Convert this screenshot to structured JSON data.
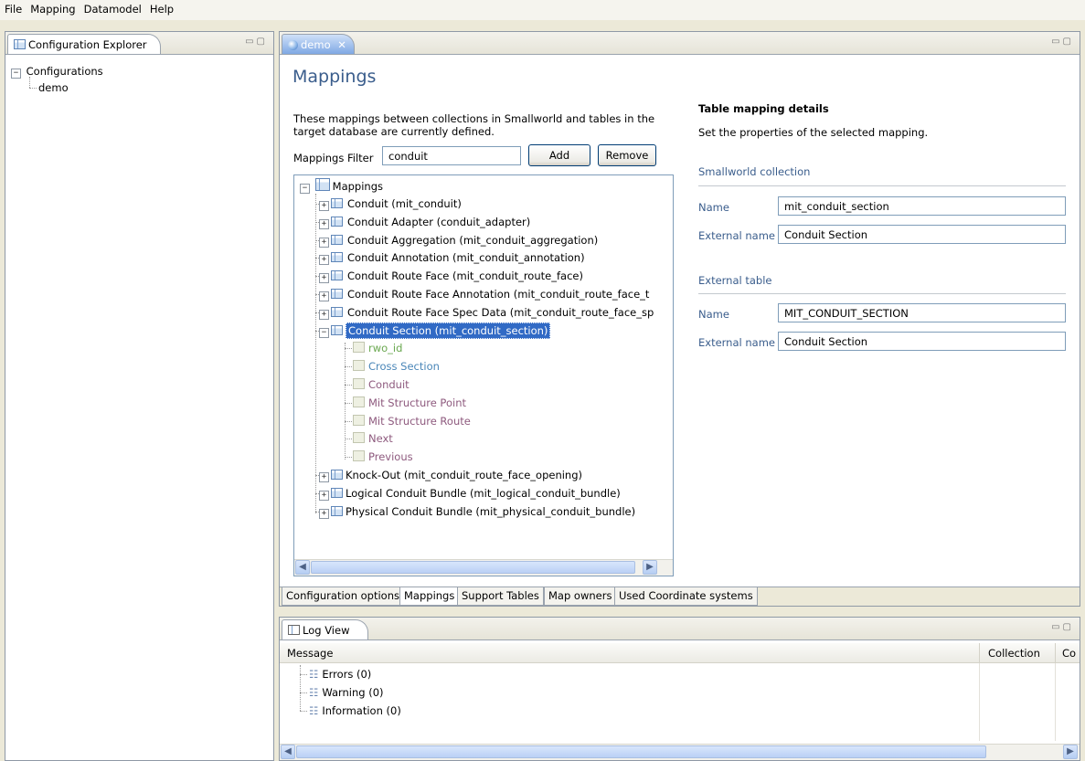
{
  "menu": [
    "File",
    "Mapping",
    "Datamodel",
    "Help"
  ],
  "explorer": {
    "tab_label": "Configuration Explorer",
    "root": "Configurations",
    "child": "demo"
  },
  "editor": {
    "tab_label": "demo",
    "title": "Mappings",
    "description_line1": "These mappings between collections in Smallworld and tables in the",
    "description_line2": "target database are currently defined.",
    "filter_label": "Mappings Filter",
    "filter_value": "conduit",
    "add_label": "Add",
    "remove_label": "Remove",
    "tree_root": "Mappings",
    "tree_items": [
      "Conduit (mit_conduit)",
      "Conduit Adapter (conduit_adapter)",
      "Conduit Aggregation (mit_conduit_aggregation)",
      "Conduit Annotation (mit_conduit_annotation)",
      "Conduit Route Face (mit_conduit_route_face)",
      "Conduit Route Face Annotation (mit_conduit_route_face_t",
      "Conduit Route Face Spec Data (mit_conduit_route_face_sp",
      "Conduit Section (mit_conduit_section)"
    ],
    "tree_fields": [
      {
        "label": "rwo_id",
        "color": "#6aa84f"
      },
      {
        "label": "Cross Section",
        "color": "#4a86b8"
      },
      {
        "label": "Conduit",
        "color": "#8e5a7e"
      },
      {
        "label": "Mit Structure Point",
        "color": "#8e5a7e"
      },
      {
        "label": "Mit Structure Route",
        "color": "#8e5a7e"
      },
      {
        "label": "Next",
        "color": "#8e5a7e"
      },
      {
        "label": "Previous",
        "color": "#8e5a7e"
      }
    ],
    "tree_items_after": [
      "Knock-Out (mit_conduit_route_face_opening)",
      "Logical Conduit Bundle (mit_logical_conduit_bundle)",
      "Physical Conduit Bundle (mit_physical_conduit_bundle)"
    ],
    "details": {
      "title": "Table mapping details",
      "subtitle": "Set the properties of the selected mapping.",
      "sw_section": "Smallworld collection",
      "name_label": "Name",
      "name_value": "mit_conduit_section",
      "ext_name_label": "External name",
      "ext_name_value": "Conduit Section",
      "ext_table_section": "External table",
      "table_name_label": "Name",
      "table_name_value": "MIT_CONDUIT_SECTION",
      "table_ext_name_label": "External name",
      "table_ext_name_value": "Conduit Section"
    },
    "bottom_tabs": [
      "Configuration options",
      "Mappings",
      "Support Tables",
      "Map owners",
      "Used Coordinate systems"
    ]
  },
  "log": {
    "tab_label": "Log View",
    "columns": [
      "Message",
      "Collection",
      "Co"
    ],
    "rows": [
      "Errors (0)",
      "Warning (0)",
      "Information (0)"
    ]
  },
  "colors": {
    "selection": "#316ac5",
    "section_blue": "#3a5d8c"
  }
}
